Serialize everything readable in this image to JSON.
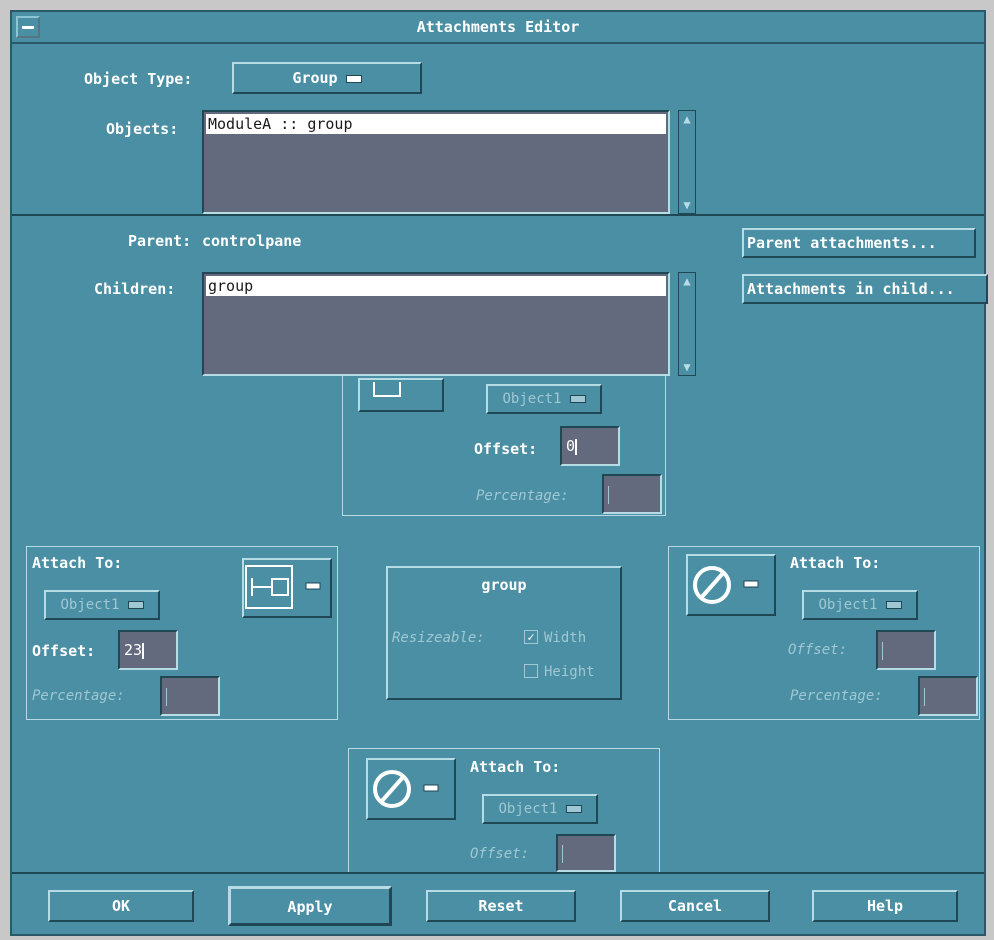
{
  "window": {
    "title": "Attachments Editor"
  },
  "object_type": {
    "label": "Object Type:",
    "value": "Group"
  },
  "objects": {
    "label": "Objects:",
    "items": [
      "ModuleA :: group"
    ]
  },
  "parent": {
    "label": "Parent:",
    "value": "controlpane"
  },
  "children": {
    "label": "Children:",
    "items": [
      "group"
    ]
  },
  "buttons_right": {
    "parent_attachments": "Parent attachments...",
    "attachments_in_child": "Attachments in child..."
  },
  "top_attach": {
    "object_option": "Object1",
    "offset_label": "Offset:",
    "offset_value": "0",
    "percentage_label": "Percentage:"
  },
  "left_attach": {
    "attach_label": "Attach To:",
    "object_option": "Object1",
    "offset_label": "Offset:",
    "offset_value": "23",
    "percentage_label": "Percentage:"
  },
  "center": {
    "name": "group",
    "resizable_label": "Resizeable:",
    "width_label": "Width",
    "width_checked": true,
    "height_label": "Height",
    "height_checked": false
  },
  "right_attach": {
    "attach_label": "Attach To:",
    "object_option": "Object1",
    "offset_label": "Offset:",
    "percentage_label": "Percentage:"
  },
  "bottom_attach": {
    "attach_label": "Attach To:",
    "object_option": "Object1",
    "offset_label": "Offset:"
  },
  "footer": {
    "ok": "OK",
    "apply": "Apply",
    "reset": "Reset",
    "cancel": "Cancel",
    "help": "Help"
  }
}
